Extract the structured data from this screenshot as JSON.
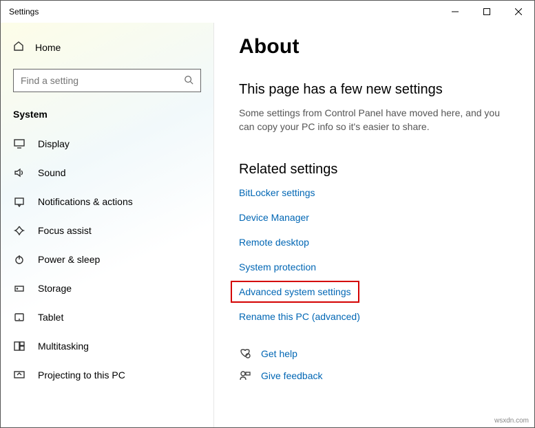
{
  "window": {
    "title": "Settings"
  },
  "sidebar": {
    "home": "Home",
    "search_placeholder": "Find a setting",
    "section": "System",
    "items": [
      {
        "label": "Display"
      },
      {
        "label": "Sound"
      },
      {
        "label": "Notifications & actions"
      },
      {
        "label": "Focus assist"
      },
      {
        "label": "Power & sleep"
      },
      {
        "label": "Storage"
      },
      {
        "label": "Tablet"
      },
      {
        "label": "Multitasking"
      },
      {
        "label": "Projecting to this PC"
      }
    ]
  },
  "content": {
    "title": "About",
    "subhead": "This page has a few new settings",
    "description": "Some settings from Control Panel have moved here, and you can copy your PC info so it's easier to share.",
    "related_heading": "Related settings",
    "related_links": [
      {
        "label": "BitLocker settings",
        "highlight": false
      },
      {
        "label": "Device Manager",
        "highlight": false
      },
      {
        "label": "Remote desktop",
        "highlight": false
      },
      {
        "label": "System protection",
        "highlight": false
      },
      {
        "label": "Advanced system settings",
        "highlight": true
      },
      {
        "label": "Rename this PC (advanced)",
        "highlight": false
      }
    ],
    "help": {
      "get_help": "Get help",
      "feedback": "Give feedback"
    }
  },
  "watermark": "wsxdn.com"
}
